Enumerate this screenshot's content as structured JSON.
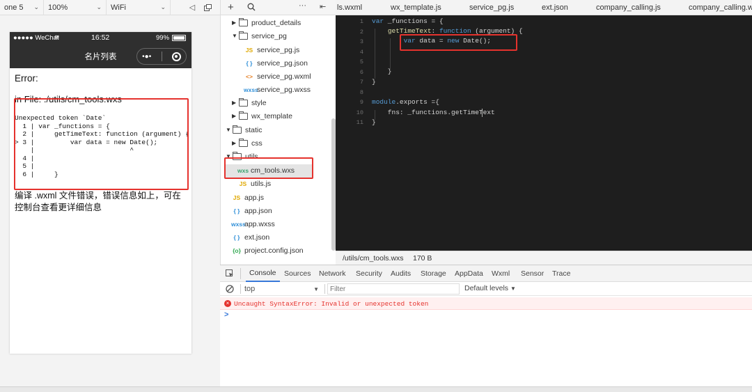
{
  "simulator_toolbar": {
    "device": "one 5",
    "zoom": "100%",
    "network": "WiFi"
  },
  "phone": {
    "status_bar": {
      "carrier": "●●●●● WeChat",
      "time": "16:52",
      "battery": "99%"
    },
    "nav_title": "名片列表",
    "error_title": "Error:",
    "error_file": "in File: ./utils/cm_tools.wxs",
    "error_code": "Unexpected token `Date`\n  1 | var _functions = {\n  2 |     getTimeText: function (argument) {\n> 3 |         var data = new Date();\n    |                        ^\n  4 |\n  5 |\n  6 |     }",
    "compile_message": "编译 .wxml 文件错误，错误信息如上，可在控制台查看更详细信息"
  },
  "file_tree": {
    "items": [
      {
        "label": "product_details",
        "type": "folder",
        "state": "collapsed",
        "depth": 1
      },
      {
        "label": "service_pg",
        "type": "folder",
        "state": "expanded",
        "depth": 1
      },
      {
        "label": "service_pg.js",
        "type": "js",
        "depth": 2
      },
      {
        "label": "service_pg.json",
        "type": "json",
        "depth": 2
      },
      {
        "label": "service_pg.wxml",
        "type": "wxml",
        "depth": 2
      },
      {
        "label": "service_pg.wxss",
        "type": "wxss",
        "depth": 2
      },
      {
        "label": "style",
        "type": "folder",
        "state": "collapsed",
        "depth": 1
      },
      {
        "label": "wx_template",
        "type": "folder",
        "state": "collapsed",
        "depth": 1
      },
      {
        "label": "static",
        "type": "folder",
        "state": "expanded",
        "depth": 0
      },
      {
        "label": "css",
        "type": "folder",
        "state": "collapsed",
        "depth": 1
      },
      {
        "label": "utils",
        "type": "folder",
        "state": "expanded",
        "depth": 0
      },
      {
        "label": "cm_tools.wxs",
        "type": "wxs",
        "depth": 1,
        "selected": true
      },
      {
        "label": "utils.js",
        "type": "js",
        "depth": 1
      },
      {
        "label": "app.js",
        "type": "js",
        "depth": 0
      },
      {
        "label": "app.json",
        "type": "json",
        "depth": 0
      },
      {
        "label": "app.wxss",
        "type": "wxss",
        "depth": 0
      },
      {
        "label": "ext.json",
        "type": "json",
        "depth": 0
      },
      {
        "label": "project.config.json",
        "type": "config",
        "depth": 0
      }
    ]
  },
  "editor": {
    "tabs": [
      "ls.wxml",
      "wx_template.js",
      "service_pg.js",
      "ext.json",
      "company_calling.js",
      "company_calling.wx"
    ],
    "line_numbers": [
      "1",
      "2",
      "3",
      "4",
      "5",
      "6",
      "7",
      "8",
      "9",
      "10",
      "11"
    ],
    "status_path": "/utils/cm_tools.wxs",
    "status_size": "170 B"
  },
  "devtools": {
    "tabs": [
      "Console",
      "Sources",
      "Network",
      "Security",
      "Audits",
      "Storage",
      "AppData",
      "Wxml",
      "Sensor",
      "Trace"
    ],
    "active_tab": "Console",
    "context": "top",
    "filter_placeholder": "Filter",
    "levels": "Default levels",
    "error": "Uncaught SyntaxError: Invalid or unexpected token",
    "prompt": ">"
  },
  "colors": {
    "highlight": "#e5322d",
    "keyword": "#569cd6",
    "function_name": "#dcdcaa",
    "editor_bg": "#1e1e1e",
    "selected_row": "#e4e4e4"
  }
}
